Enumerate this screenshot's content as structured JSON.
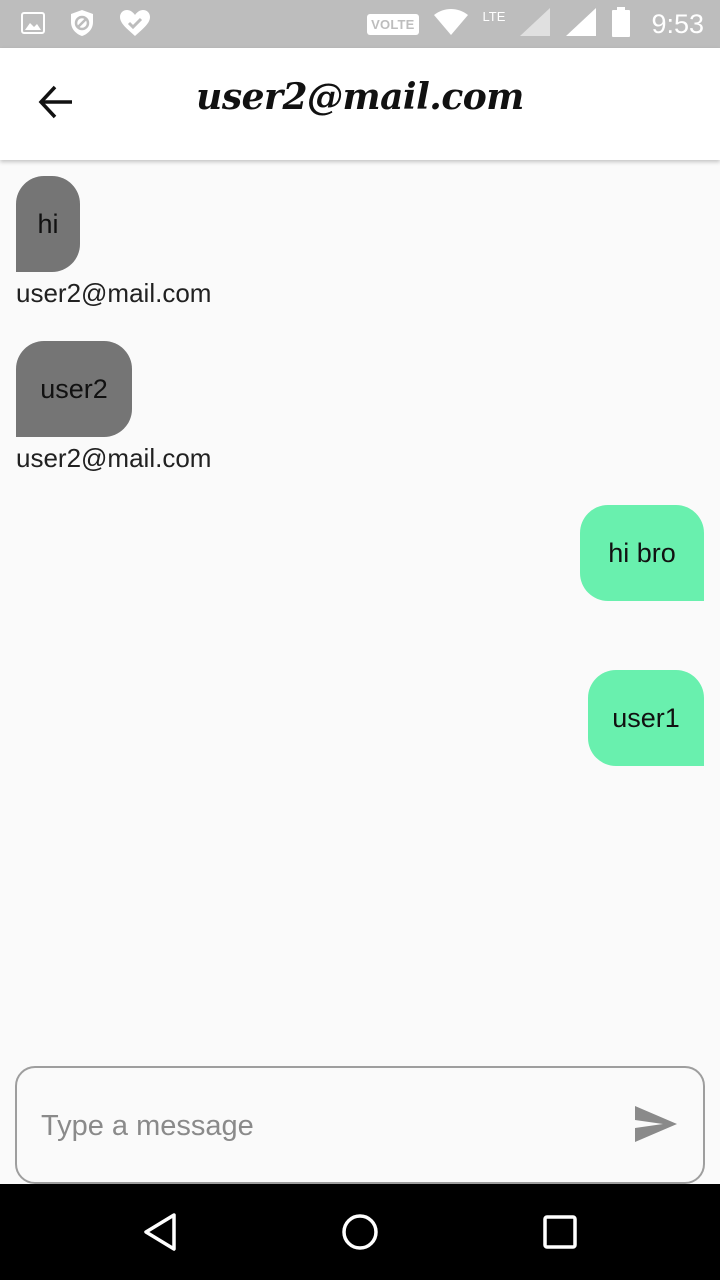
{
  "status_bar": {
    "time": "9:53",
    "volte": "VOLTE",
    "lte": "LTE",
    "left_icons": [
      "gallery-icon",
      "shield-icon",
      "heart-check-icon"
    ],
    "right_icons": [
      "wifi-icon",
      "signal-icon",
      "signal-icon",
      "battery-icon"
    ]
  },
  "app_bar": {
    "title": "user2@mail.com",
    "back_icon": "arrow-back-icon"
  },
  "messages": [
    {
      "text": "hi",
      "direction": "received",
      "sender": "user2@mail.com"
    },
    {
      "text": "user2",
      "direction": "received",
      "sender": "user2@mail.com"
    },
    {
      "text": "hi bro",
      "direction": "sent"
    },
    {
      "text": "user1",
      "direction": "sent"
    }
  ],
  "composer": {
    "placeholder": "Type a message",
    "value": "",
    "send_icon": "send-icon"
  },
  "nav_bar": {
    "icons": [
      "back-triangle-icon",
      "home-circle-icon",
      "recents-square-icon"
    ]
  },
  "colors": {
    "status_bar": "#bdbdbd",
    "received_bubble": "#757575",
    "sent_bubble": "#69f0ae",
    "background": "#fafafa",
    "nav_bar": "#000000"
  }
}
